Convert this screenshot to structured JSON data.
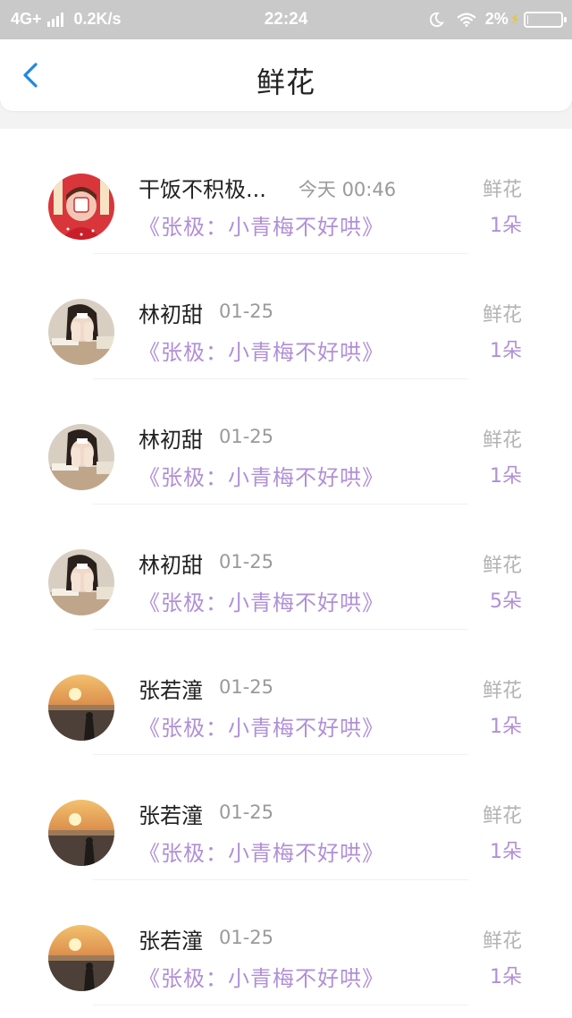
{
  "status_bar": {
    "network": "4G+",
    "speed": "0.2K/s",
    "time": "22:24",
    "battery_percent": "2%",
    "battery_level": 0.02,
    "icons": [
      "signal-icon",
      "moon-icon",
      "wifi-icon",
      "charging-icon",
      "battery-icon"
    ]
  },
  "header": {
    "title": "鲜花",
    "back_icon": "chevron-left-icon",
    "accent_color": "#1e88e5"
  },
  "colors": {
    "book_text": "#b08fd8",
    "count_text": "#b08fd8",
    "label_text": "#b3b3b3"
  },
  "rows": [
    {
      "name": "干饭不积极...",
      "time": "今天 00:46",
      "book": "《张极：小青梅不好哄》",
      "gift": "鲜花",
      "count": "1朵",
      "avatar": "red-cartoon-avatar"
    },
    {
      "name": "林初甜",
      "time": "01-25",
      "book": "《张极：小青梅不好哄》",
      "gift": "鲜花",
      "count": "1朵",
      "avatar": "girl-photo-avatar"
    },
    {
      "name": "林初甜",
      "time": "01-25",
      "book": "《张极：小青梅不好哄》",
      "gift": "鲜花",
      "count": "1朵",
      "avatar": "girl-photo-avatar"
    },
    {
      "name": "林初甜",
      "time": "01-25",
      "book": "《张极：小青梅不好哄》",
      "gift": "鲜花",
      "count": "5朵",
      "avatar": "girl-photo-avatar"
    },
    {
      "name": "张若潼",
      "time": "01-25",
      "book": "《张极：小青梅不好哄》",
      "gift": "鲜花",
      "count": "1朵",
      "avatar": "sunset-beach-avatar"
    },
    {
      "name": "张若潼",
      "time": "01-25",
      "book": "《张极：小青梅不好哄》",
      "gift": "鲜花",
      "count": "1朵",
      "avatar": "sunset-beach-avatar"
    },
    {
      "name": "张若潼",
      "time": "01-25",
      "book": "《张极：小青梅不好哄》",
      "gift": "鲜花",
      "count": "1朵",
      "avatar": "sunset-beach-avatar"
    }
  ]
}
